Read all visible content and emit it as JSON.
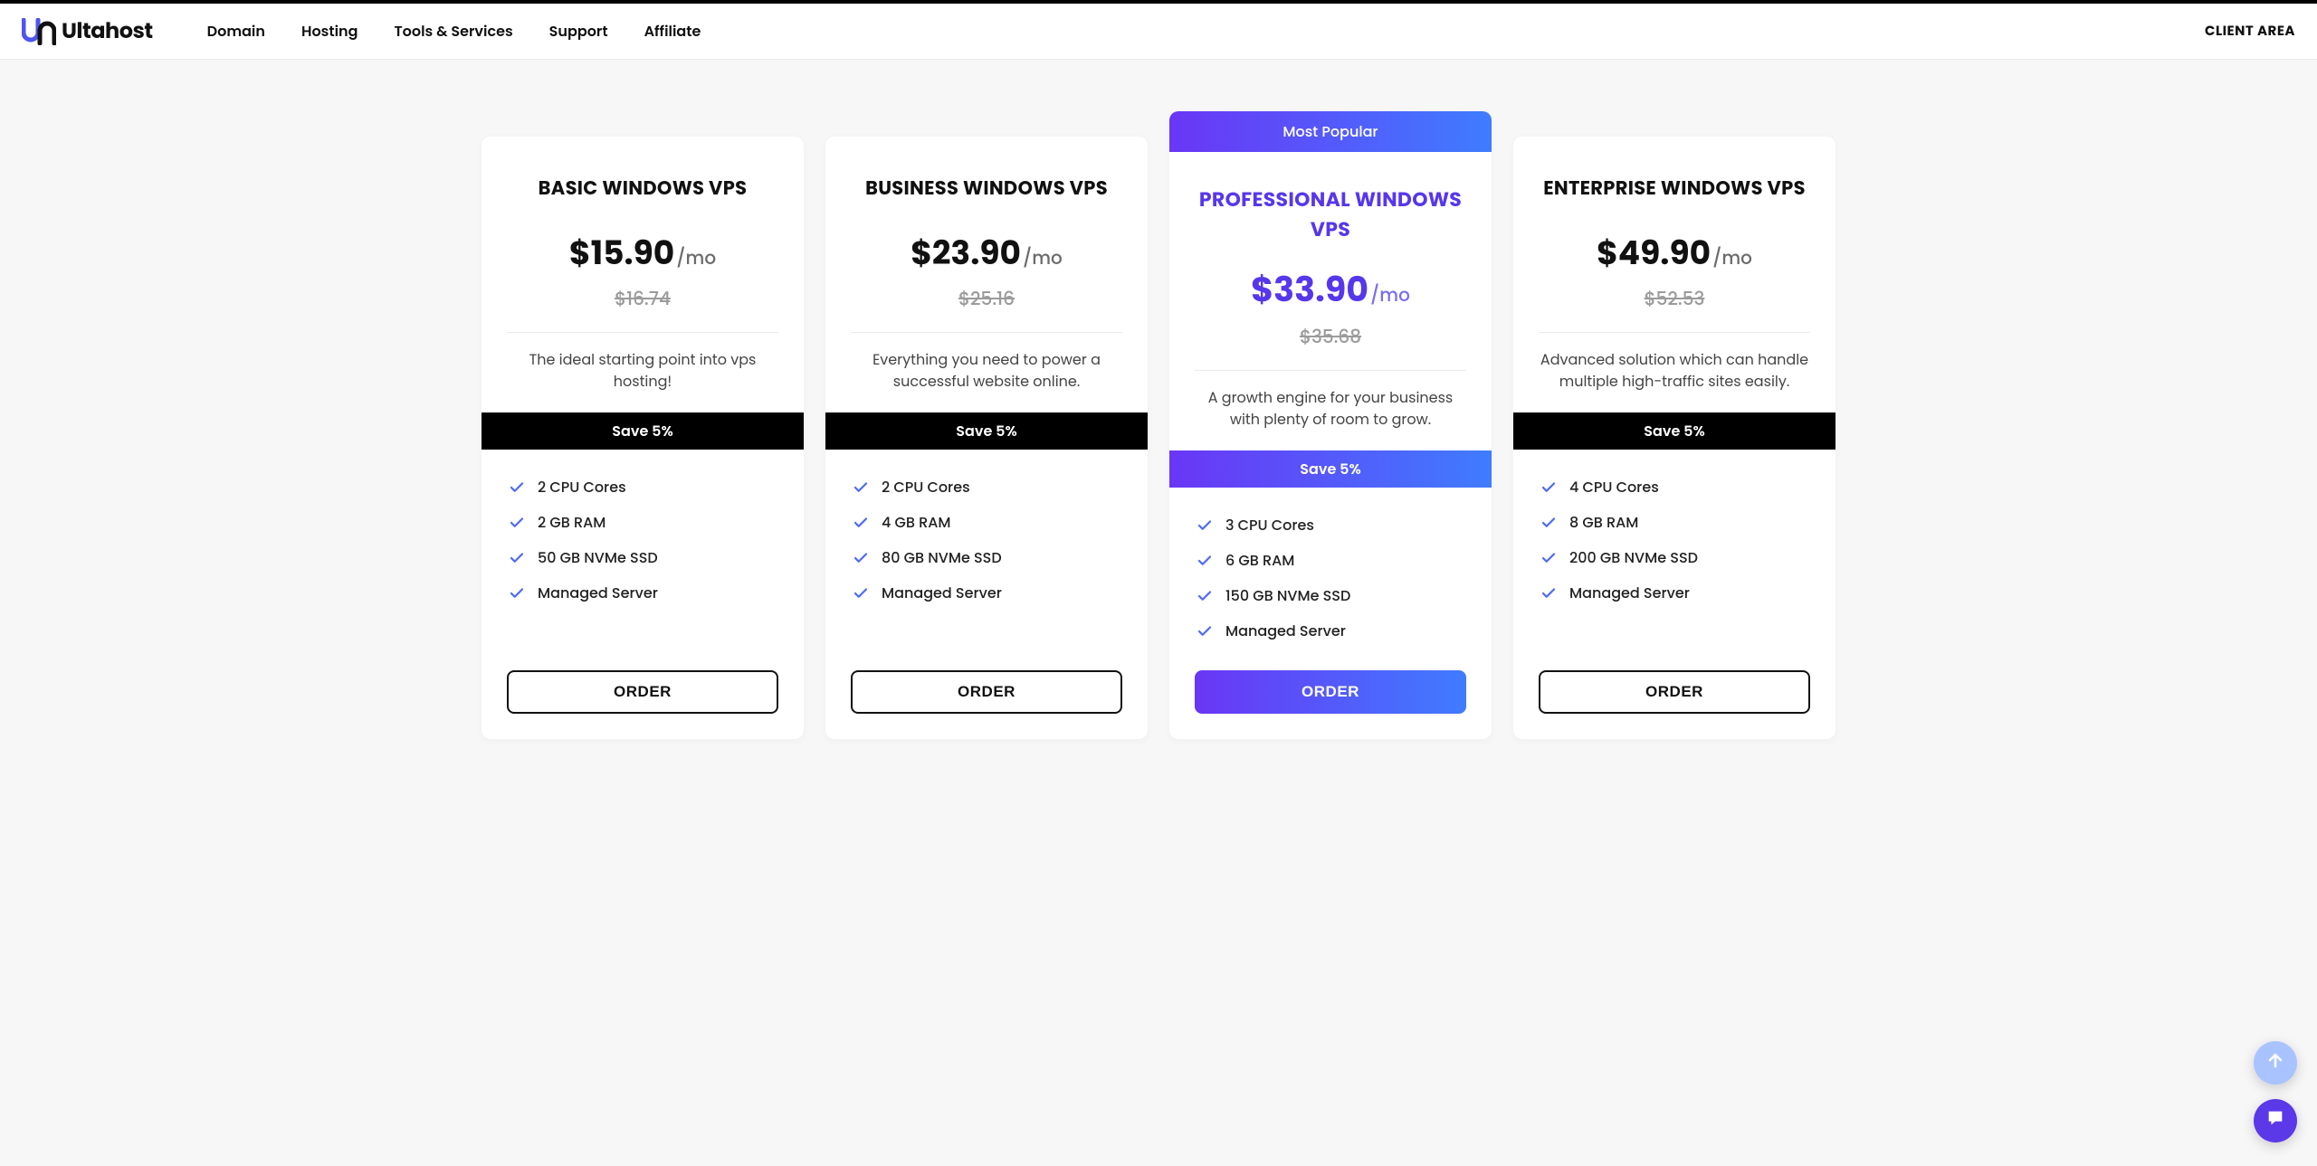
{
  "brand": {
    "name": "Ultahost"
  },
  "nav": {
    "items": [
      "Domain",
      "Hosting",
      "Tools & Services",
      "Support",
      "Affiliate"
    ],
    "client_area": "CLIENT AREA"
  },
  "popular_badge": "Most Popular",
  "per_label": "/mo",
  "order_label": "ORDER",
  "plans": [
    {
      "title": "BASIC WINDOWS VPS",
      "price": "$15.90",
      "old_price": "$16.74",
      "tagline": "The ideal starting point into vps hosting!",
      "save": "Save 5%",
      "features": [
        "2 CPU Cores",
        "2 GB RAM",
        "50 GB NVMe SSD",
        "Managed Server"
      ],
      "popular": false
    },
    {
      "title": "BUSINESS WINDOWS VPS",
      "price": "$23.90",
      "old_price": "$25.16",
      "tagline": "Everything you need to power a successful website online.",
      "save": "Save 5%",
      "features": [
        "2 CPU Cores",
        "4 GB RAM",
        "80 GB NVMe SSD",
        "Managed Server"
      ],
      "popular": false
    },
    {
      "title": "PROFESSIONAL WINDOWS VPS",
      "price": "$33.90",
      "old_price": "$35.68",
      "tagline": "A growth engine for your business with plenty of room to grow.",
      "save": "Save 5%",
      "features": [
        "3 CPU Cores",
        "6 GB RAM",
        "150 GB NVMe SSD",
        "Managed Server"
      ],
      "popular": true
    },
    {
      "title": "ENTERPRISE WINDOWS VPS",
      "price": "$49.90",
      "old_price": "$52.53",
      "tagline": "Advanced solution which can handle multiple high-traffic sites easily.",
      "save": "Save 5%",
      "features": [
        "4 CPU Cores",
        "8 GB RAM",
        "200 GB NVMe SSD",
        "Managed Server"
      ],
      "popular": false
    }
  ]
}
